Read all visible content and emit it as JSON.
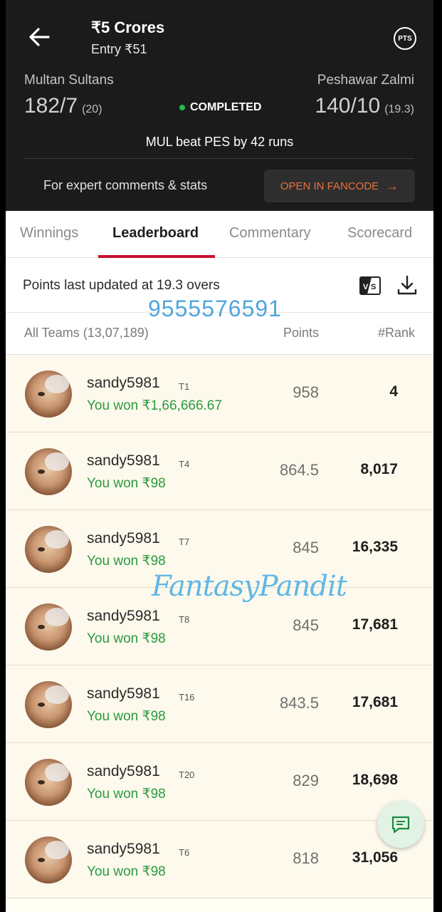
{
  "header": {
    "contest_title": "₹5 Crores",
    "entry": "Entry ₹51",
    "pts_label": "PTS",
    "team_a": {
      "name": "Multan Sultans",
      "score": "182/7",
      "overs": "(20)"
    },
    "team_b": {
      "name": "Peshawar Zalmi",
      "score": "140/10",
      "overs": "(19.3)"
    },
    "status": "COMPLETED",
    "result": "MUL beat PES by 42 runs",
    "expert_text": "For expert comments & stats",
    "fancode_button": "OPEN IN FANCODE",
    "icons": {
      "back": "arrow-left-icon",
      "pts": "pts-icon",
      "fancode_arrow": "arrow-right-icon"
    }
  },
  "tabs": [
    {
      "label": "Winnings",
      "active": false
    },
    {
      "label": "Leaderboard",
      "active": true
    },
    {
      "label": "Commentary",
      "active": false
    },
    {
      "label": "Scorecard",
      "active": false
    }
  ],
  "info": {
    "updated": "Points last updated at 19.3 overs",
    "icons": {
      "compare": "vs-compare-icon",
      "download": "download-icon"
    }
  },
  "columns": {
    "teams": "All Teams (13,07,189)",
    "points": "Points",
    "rank": "#Rank"
  },
  "rows": [
    {
      "username": "sandy5981",
      "team": "T1",
      "won": "You won ₹1,66,666.67",
      "points": "958",
      "rank": "4"
    },
    {
      "username": "sandy5981",
      "team": "T4",
      "won": "You won ₹98",
      "points": "864.5",
      "rank": "8,017"
    },
    {
      "username": "sandy5981",
      "team": "T7",
      "won": "You won ₹98",
      "points": "845",
      "rank": "16,335"
    },
    {
      "username": "sandy5981",
      "team": "T8",
      "won": "You won ₹98",
      "points": "845",
      "rank": "17,681"
    },
    {
      "username": "sandy5981",
      "team": "T16",
      "won": "You won ₹98",
      "points": "843.5",
      "rank": "17,681"
    },
    {
      "username": "sandy5981",
      "team": "T20",
      "won": "You won ₹98",
      "points": "829",
      "rank": "18,698"
    },
    {
      "username": "sandy5981",
      "team": "T6",
      "won": "You won ₹98",
      "points": "818",
      "rank": "31,056"
    }
  ],
  "watermarks": {
    "phone": "9555576591",
    "brand": "FantasyPandit"
  },
  "colors": {
    "header_bg": "#1b1b1b",
    "accent_red": "#c8102e",
    "won_green": "#2b9a3f",
    "fancode_orange": "#e8703a",
    "row_bg": "#fdf9ec"
  },
  "fab": {
    "icon": "chat-icon"
  }
}
